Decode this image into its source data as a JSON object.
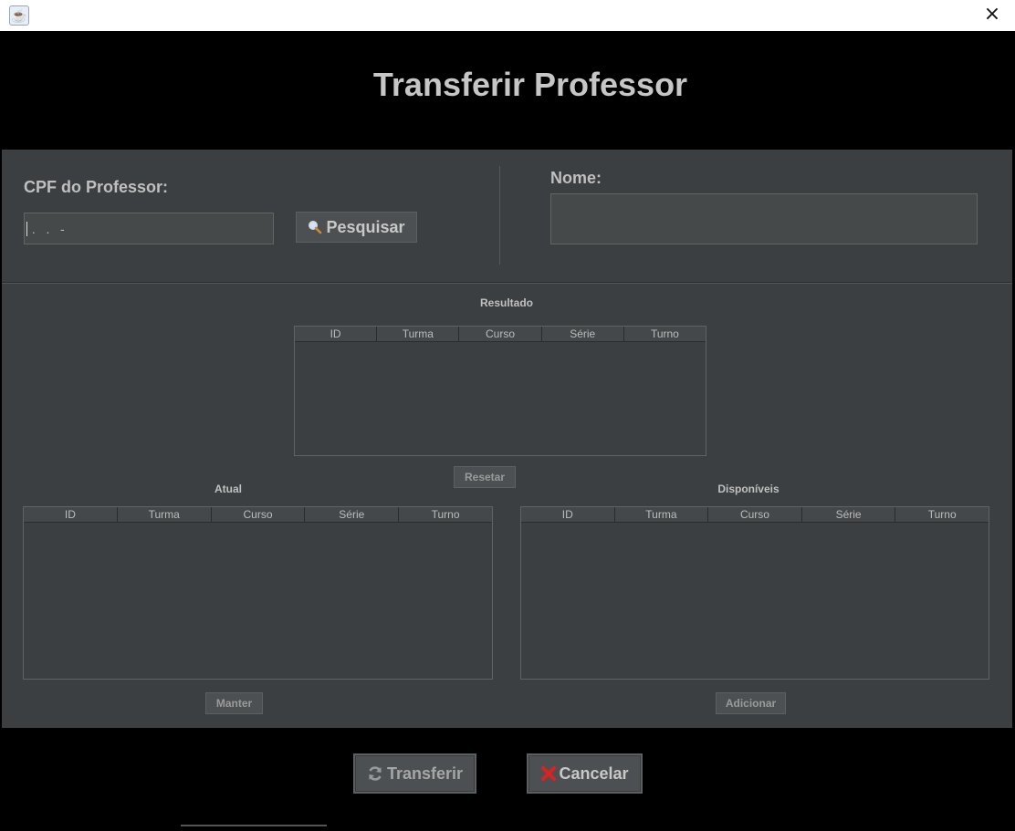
{
  "window": {
    "title": "",
    "app_icon": "java-cup-icon",
    "close_label": "×"
  },
  "header": {
    "title": "Transferir Professor"
  },
  "search": {
    "cpf_label": "CPF do Professor:",
    "cpf_value": " .   .   -",
    "search_button": "Pesquisar",
    "search_icon": "magnifier-icon",
    "nome_label": "Nome:",
    "nome_value": ""
  },
  "resultado": {
    "label": "Resultado",
    "columns": [
      "ID",
      "Turma",
      "Curso",
      "Série",
      "Turno"
    ],
    "rows": [],
    "reset_button": "Resetar"
  },
  "atual": {
    "label": "Atual",
    "columns": [
      "ID",
      "Turma",
      "Curso",
      "Série",
      "Turno"
    ],
    "rows": [],
    "keep_button": "Manter"
  },
  "disponiveis": {
    "label": "Disponíveis",
    "columns": [
      "ID",
      "Turma",
      "Curso",
      "Série",
      "Turno"
    ],
    "rows": [],
    "add_button": "Adicionar"
  },
  "footer": {
    "transfer_button": "Transferir",
    "transfer_icon": "refresh-icon",
    "cancel_button": "Cancelar",
    "cancel_icon": "red-x-icon"
  },
  "colors": {
    "panel_bg": "#3c3f41",
    "header_bg": "#000000",
    "title_text": "#c6c6c6",
    "cancel_icon": "#e02020"
  }
}
